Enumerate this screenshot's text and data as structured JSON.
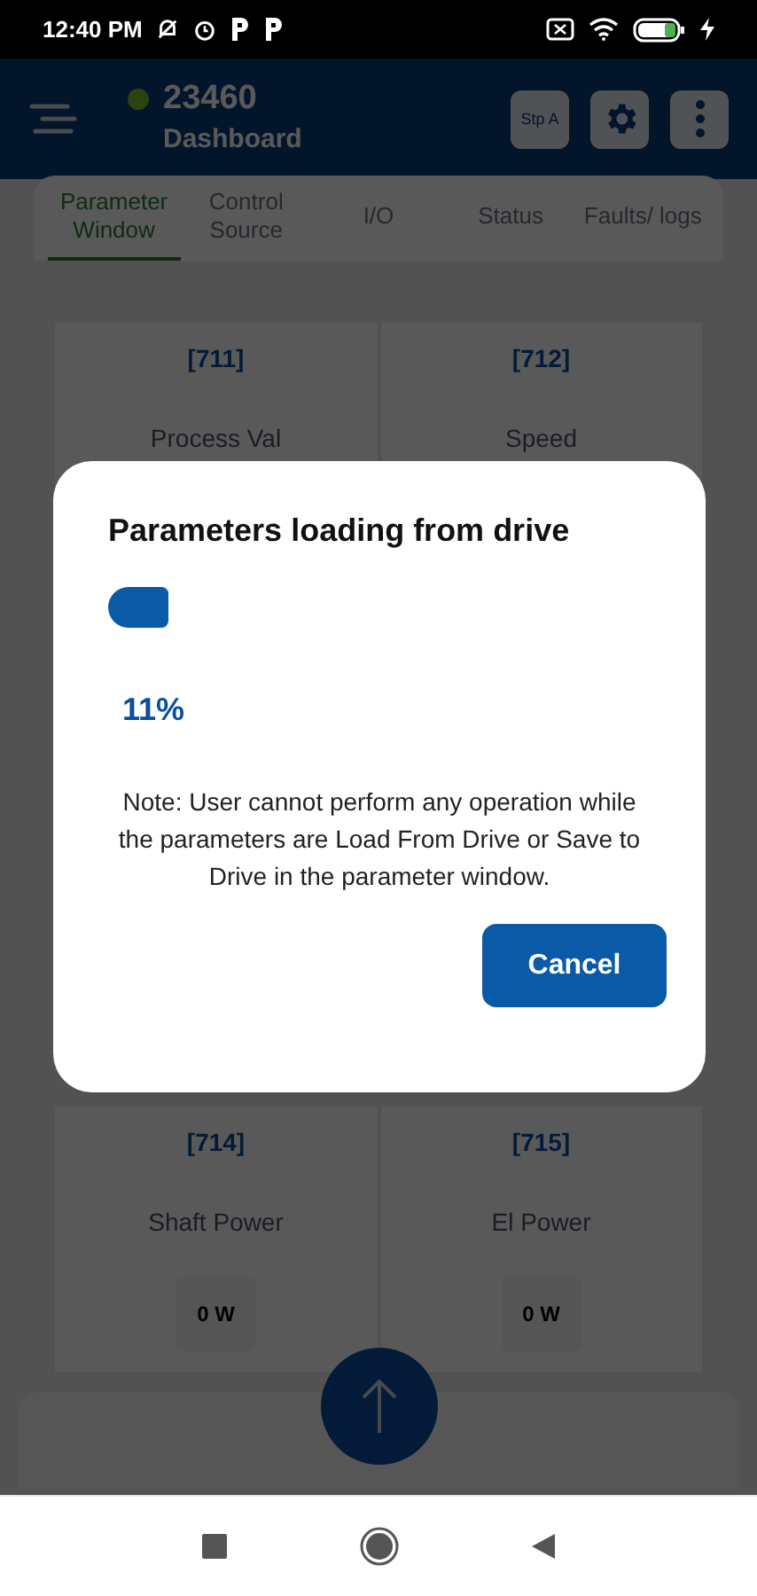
{
  "status_bar": {
    "time": "12:40 PM"
  },
  "app_bar": {
    "connected": true,
    "id": "23460",
    "subtitle": "Dashboard",
    "step_button": "Stp A"
  },
  "tabs": [
    {
      "label": "Parameter Window",
      "selected": true
    },
    {
      "label": "Control Source",
      "selected": false
    },
    {
      "label": "I/O",
      "selected": false
    },
    {
      "label": "Status",
      "selected": false
    },
    {
      "label": "Faults/ logs",
      "selected": false
    }
  ],
  "parameters_top": [
    {
      "code": "[711]",
      "name": "Process Val"
    },
    {
      "code": "[712]",
      "name": "Speed"
    }
  ],
  "parameters_bottom": [
    {
      "code": "[714]",
      "name": "Shaft Power",
      "value": "0 W"
    },
    {
      "code": "[715]",
      "name": "El Power",
      "value": "0 W"
    }
  ],
  "dialog": {
    "title": "Parameters loading from drive",
    "level": 0.11,
    "percent": "11%",
    "note": "Note: User cannot perform any operation while the parameters are Load From Drive or Save to Drive in the parameter window.",
    "button": "Cancel"
  }
}
